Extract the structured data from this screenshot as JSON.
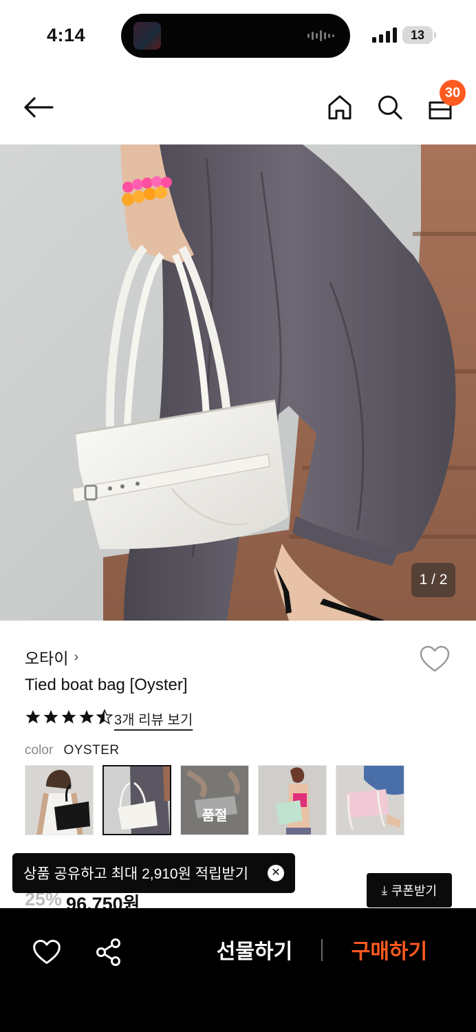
{
  "status_bar": {
    "time": "4:14",
    "battery": "13"
  },
  "nav": {
    "cart_count": "30"
  },
  "hero": {
    "counter": "1 / 2"
  },
  "product": {
    "brand": "오타이",
    "brand_chevron": "›",
    "name": "Tied boat bag [Oyster]",
    "rating": 4.5,
    "review_link": "3개 리뷰 보기",
    "color_label": "color",
    "color_value": "OYSTER",
    "swatches": [
      {
        "color": "black",
        "selected": false,
        "soldout": false
      },
      {
        "color": "oyster",
        "selected": true,
        "soldout": false
      },
      {
        "color": "silver",
        "selected": false,
        "soldout": true,
        "soldout_label": "품절"
      },
      {
        "color": "mint",
        "selected": false,
        "soldout": false
      },
      {
        "color": "pink",
        "selected": false,
        "soldout": false
      }
    ],
    "discount": "25%",
    "price": "96,750원"
  },
  "toast": {
    "text": "상품 공유하고 최대 2,910원 적립받기",
    "close": "✕"
  },
  "coupon_button": {
    "icon": "⤓",
    "label": "쿠폰받기"
  },
  "bottom_bar": {
    "gift_label": "선물하기",
    "buy_label": "구매하기"
  },
  "colors": {
    "accent": "#ff5a1f",
    "bar_bg": "#000000"
  }
}
